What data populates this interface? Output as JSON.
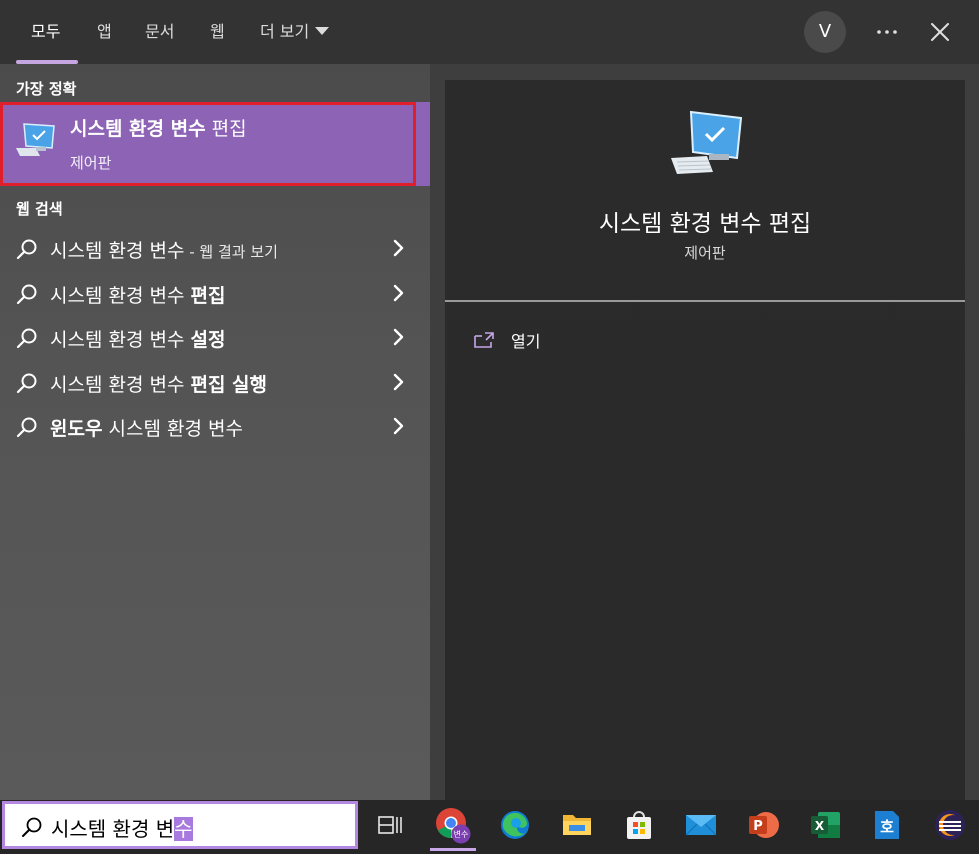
{
  "tabs": [
    {
      "label": "모두",
      "active": true
    },
    {
      "label": "앱"
    },
    {
      "label": "문서"
    },
    {
      "label": "웹"
    },
    {
      "label": "더 보기"
    }
  ],
  "avatar": {
    "initial": "V"
  },
  "best_match": {
    "section_label": "가장 정확",
    "title_bold": "시스템 환경 변수",
    "title_rest": " 편집",
    "subtitle": "제어판"
  },
  "web_search": {
    "section_label": "웹 검색",
    "rows": [
      {
        "pre": "시스템 환경 변수",
        "bold": "",
        "suffix": " - 웹 결과 보기"
      },
      {
        "pre": "시스템 환경 변수 ",
        "bold": "편집",
        "suffix": ""
      },
      {
        "pre": "시스템 환경 변수 ",
        "bold": "설정",
        "suffix": ""
      },
      {
        "pre": "시스템 환경 변수 ",
        "bold": "편집 실행",
        "suffix": ""
      },
      {
        "pre": "",
        "bold": "윈도우",
        "post": " 시스템 환경 변수",
        "suffix": ""
      }
    ]
  },
  "detail": {
    "title": "시스템 환경 변수 편집",
    "subtitle": "제어판",
    "actions": [
      {
        "label": "열기"
      }
    ]
  },
  "search": {
    "typed": "시스템 환경 변",
    "selected": "수"
  },
  "taskbar": {
    "chrome_badge": "변수",
    "hwp_label": "호"
  },
  "colors": {
    "accent": "#8c63b5",
    "highlight_border": "#e01f2d",
    "search_border": "#b488e0"
  }
}
